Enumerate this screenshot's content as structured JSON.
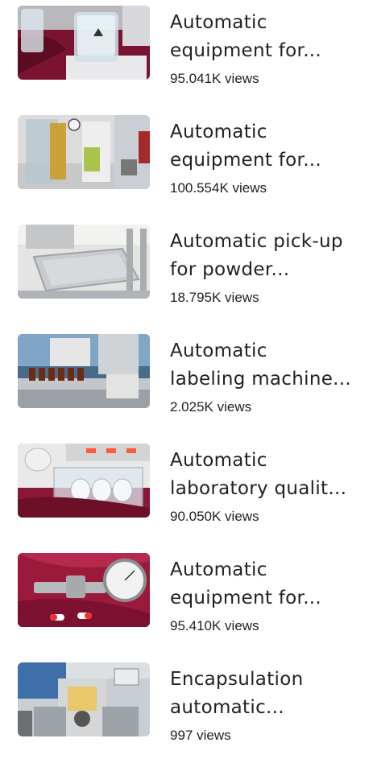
{
  "videos": [
    {
      "title_lines": [
        "Automatic",
        "equipment for..."
      ],
      "views": "95.041K views",
      "thumb_icon": "lab-beaker-stirrer-thumbnail"
    },
    {
      "title_lines": [
        "Automatic",
        "equipment for..."
      ],
      "views": "100.554K views",
      "thumb_icon": "packaging-machine-thumbnail"
    },
    {
      "title_lines": [
        "Automatic pick-up",
        "for powder..."
      ],
      "views": "18.795K views",
      "thumb_icon": "powder-tray-thumbnail"
    },
    {
      "title_lines": [
        "Automatic",
        "labeling machine..."
      ],
      "views": "2.025K views",
      "thumb_icon": "bottle-labeling-thumbnail"
    },
    {
      "title_lines": [
        "Automatic",
        "laboratory qualit..."
      ],
      "views": "90.050K views",
      "thumb_icon": "dissolution-tester-thumbnail"
    },
    {
      "title_lines": [
        "Automatic",
        "equipment for..."
      ],
      "views": "95.410K views",
      "thumb_icon": "capsule-gauge-thumbnail"
    },
    {
      "title_lines": [
        "Encapsulation",
        "automatic..."
      ],
      "views": "997 views",
      "thumb_icon": "encapsulation-machine-thumbnail"
    }
  ]
}
